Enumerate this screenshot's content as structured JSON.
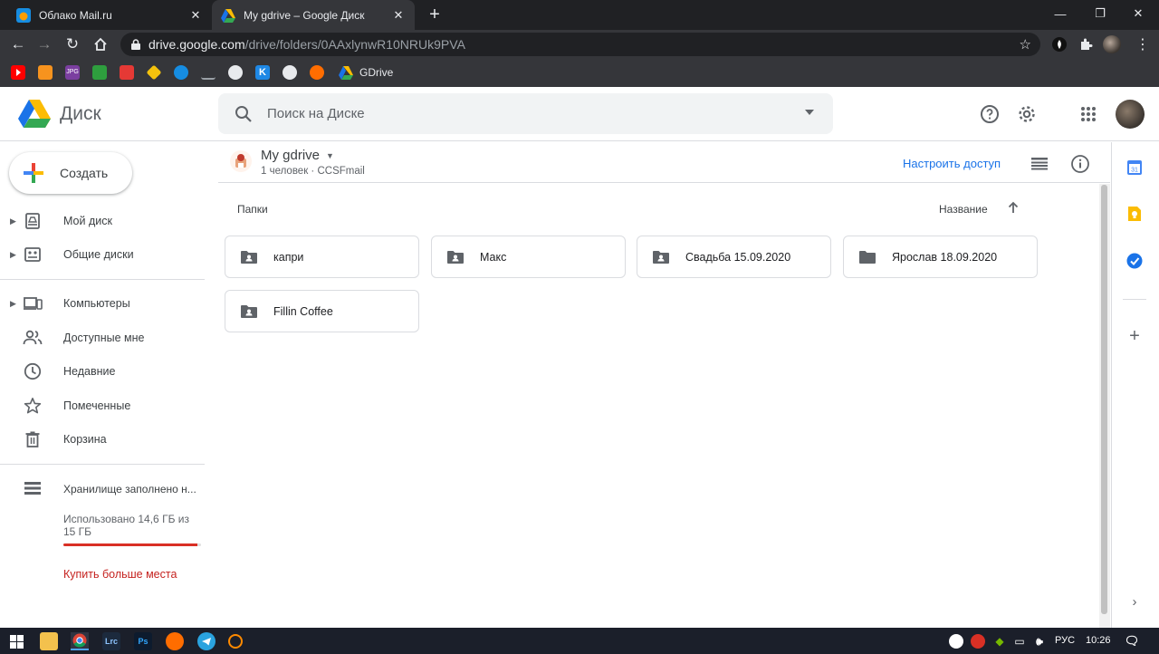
{
  "browser": {
    "tabs": [
      {
        "title": "Облако Mail.ru",
        "active": false
      },
      {
        "title": "My gdrive – Google Диск",
        "active": true
      }
    ],
    "url_host": "drive.google.com",
    "url_path": "/drive/folders/0AAxlynwR10NRUk9PVA",
    "bookmark_gdrive": "GDrive"
  },
  "header": {
    "logo_text": "Диск",
    "search_placeholder": "Поиск на Диске"
  },
  "sidebar": {
    "create_label": "Создать",
    "items": [
      {
        "label": "Мой диск",
        "icon": "my-drive-icon",
        "expandable": true
      },
      {
        "label": "Общие диски",
        "icon": "shared-drives-icon",
        "expandable": true
      },
      {
        "label": "Компьютеры",
        "icon": "computers-icon",
        "expandable": true
      },
      {
        "label": "Доступные мне",
        "icon": "shared-with-me-icon",
        "expandable": false
      },
      {
        "label": "Недавние",
        "icon": "recent-icon",
        "expandable": false
      },
      {
        "label": "Помеченные",
        "icon": "starred-icon",
        "expandable": false
      },
      {
        "label": "Корзина",
        "icon": "trash-icon",
        "expandable": false
      }
    ],
    "storage_label": "Хранилище заполнено н...",
    "storage_used": "Использовано 14,6 ГБ из 15 ГБ",
    "storage_fraction": 0.973,
    "buy_label": "Купить больше места"
  },
  "main": {
    "drive_title": "My gdrive",
    "drive_subtitle": "1 человек · CCSFmail",
    "share_label": "Настроить доступ",
    "section_title": "Папки",
    "sort_label": "Название",
    "folders": [
      {
        "name": "капри",
        "shared": true
      },
      {
        "name": "Макс",
        "shared": true
      },
      {
        "name": "Свадьба 15.09.2020",
        "shared": true
      },
      {
        "name": "Ярослав 18.09.2020",
        "shared": false
      },
      {
        "name": "Fillin Coffee",
        "shared": true
      }
    ]
  },
  "taskbar": {
    "language": "РУС",
    "time": "10:26",
    "lrc_label": "Lrc",
    "ps_label": "Ps"
  },
  "colors": {
    "accent": "#1a73e8",
    "storage_warning": "#d93025",
    "buy_link": "#c5221f"
  }
}
